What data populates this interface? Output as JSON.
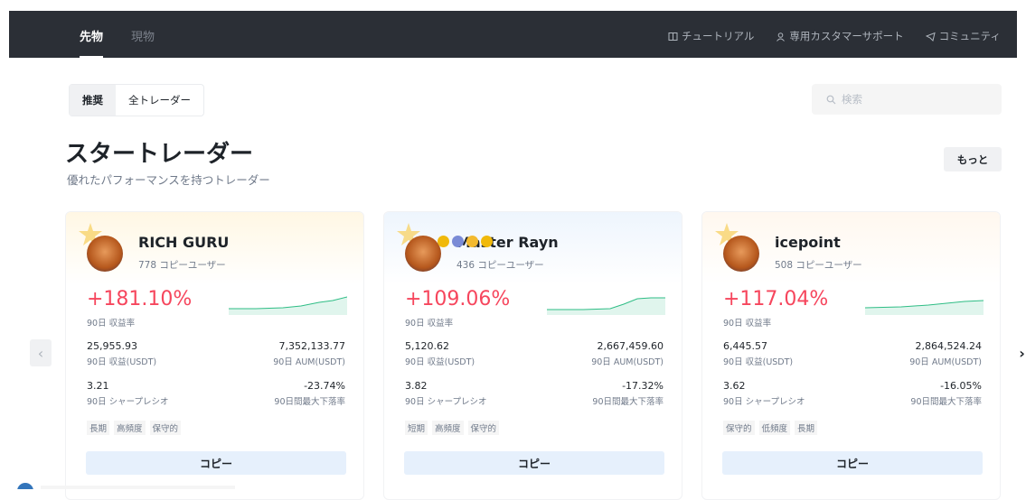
{
  "nav": {
    "tabs": [
      "先物",
      "現物"
    ],
    "links": [
      {
        "icon": "book-icon",
        "label": "チュートリアル"
      },
      {
        "icon": "support-agent-icon",
        "label": "専用カスタマーサポート"
      },
      {
        "icon": "telegram-icon",
        "label": "コミュニティ"
      }
    ]
  },
  "filters": {
    "recommended": "推奨",
    "all": "全トレーダー"
  },
  "search": {
    "placeholder": "検索"
  },
  "section": {
    "title": "スタートレーダー",
    "subtitle": "優れたパフォーマンスを持つトレーダー",
    "more": "もっと"
  },
  "traders": [
    {
      "name": "RICH GURU",
      "followers": "778 コピーユーザー",
      "roi": "+181.10%",
      "roi_label": "90日 収益率",
      "pnl": "25,955.93",
      "pnl_label": "90日 収益(USDT)",
      "aum": "7,352,133.77",
      "aum_label": "90日 AUM(USDT)",
      "sharpe": "3.21",
      "sharpe_label": "90日 シャープレシオ",
      "mdd": "-23.74%",
      "mdd_label": "90日間最大下落率",
      "tags": [
        "長期",
        "高頻度",
        "保守的"
      ],
      "copy": "コピー",
      "badge_count": 3
    },
    {
      "name": "Master Rayn",
      "followers": "436 コピーユーザー",
      "roi": "+109.06%",
      "roi_label": "90日 収益率",
      "pnl": "5,120.62",
      "pnl_label": "90日 収益(USDT)",
      "aum": "2,667,459.60",
      "aum_label": "90日 AUM(USDT)",
      "sharpe": "3.82",
      "sharpe_label": "90日 シャープレシオ",
      "mdd": "-17.32%",
      "mdd_label": "90日間最大下落率",
      "tags": [
        "短期",
        "高頻度",
        "保守的"
      ],
      "copy": "コピー",
      "badge_count": 4
    },
    {
      "name": "icepoint",
      "followers": "508 コピーユーザー",
      "roi": "+117.04%",
      "roi_label": "90日 収益率",
      "pnl": "6,445.57",
      "pnl_label": "90日 収益(USDT)",
      "aum": "2,864,524.24",
      "aum_label": "90日 AUM(USDT)",
      "sharpe": "3.62",
      "sharpe_label": "90日 シャープレシオ",
      "mdd": "-16.05%",
      "mdd_label": "90日間最大下落率",
      "tags": [
        "保守的",
        "低頻度",
        "長期"
      ],
      "copy": "コピー",
      "badge_count": 3
    }
  ],
  "colors": {
    "profit": "#f6465d",
    "spark": "#2ebd85",
    "copy_bg": "#e6f0fc"
  }
}
